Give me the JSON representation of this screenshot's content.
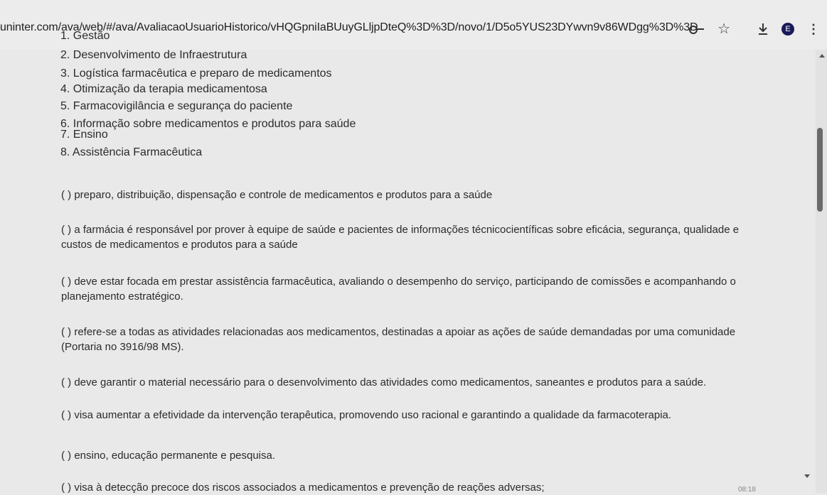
{
  "browser": {
    "url": "uninter.com/ava/web/#/ava/AvaliacaoUsuarioHistorico/vHQGpniIaBUuyGLljpDteQ%3D%3D/novo/1/D5o5YUS23DYwvn9v86WDgg%3D%3D",
    "profile_initial": "E",
    "icons": [
      "key-icon",
      "star-icon",
      "download-icon",
      "avatar",
      "kebab-menu-icon"
    ]
  },
  "question": {
    "options": [
      "1. Gestão",
      "2. Desenvolvimento de Infraestrutura",
      "3. Logística farmacêutica e preparo de medicamentos",
      "4. Otimização da terapia medicamentosa",
      "5. Farmacovigilância e segurança do paciente",
      "6. Informação sobre medicamentos e produtos para saúde",
      "7. Ensino",
      "8. Assistência Farmacêutica"
    ],
    "statements": [
      "( ) preparo, distribuição, dispensação e controle de medicamentos e produtos para a saúde",
      "( ) a farmácia é responsável por prover à equipe de saúde e pacientes de informações técnicocientíficas sobre eficácia, segurança, qualidade e custos de medicamentos e produtos para a saúde",
      "( ) deve estar focada em prestar assistência farmacêutica, avaliando o desempenho do serviço, participando de comissões e acompanhando o planejamento estratégico.",
      "( ) refere-se a todas as atividades relacionadas aos medicamentos, destinadas a apoiar as ações de saúde demandadas por uma comunidade (Portaria no 3916/98 MS).",
      "( ) deve garantir o material necessário para o desenvolvimento das atividades como medicamentos, saneantes e produtos para a saúde.",
      "( ) visa aumentar a efetividade da intervenção terapêutica, promovendo uso racional e garantindo a qualidade da farmacoterapia.",
      "( ) ensino, educação permanente e pesquisa.",
      "( ) visa à detecção precoce dos riscos associados a medicamentos e prevenção de reações adversas;"
    ]
  },
  "clock": "08:18"
}
